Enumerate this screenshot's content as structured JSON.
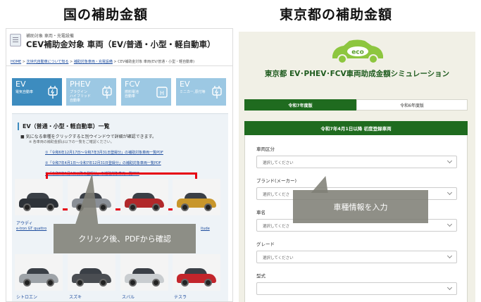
{
  "headings": {
    "left": "国の補助金額",
    "right": "東京都の補助金額"
  },
  "left_page": {
    "category": "補助対象 車両・充電設備",
    "title": "CEV補助金対象 車両（EV/普通・小型・軽自動車）",
    "breadcrumb": {
      "home": "HOME",
      "sep": ">",
      "items": [
        "次世代自動車について知る",
        "補助対象車両・充電設備",
        "CEV補助金対象 車両(EV/普通・小型・軽自動車)"
      ]
    },
    "tiles": [
      {
        "title": "EV",
        "sub1": "電気自動車",
        "sub2": "",
        "sub3": "",
        "icon": "ev-plug-icon"
      },
      {
        "title": "PHEV",
        "sub1": "プラグイン",
        "sub2": "ハイブリッド",
        "sub3": "自動車",
        "icon": "phev-plug-icon"
      },
      {
        "title": "FCV",
        "sub1": "燃料電池",
        "sub2": "自動車",
        "sub3": "",
        "icon": "fcv-h2-icon"
      },
      {
        "title": "EV",
        "sub1": "ミニカー,原付等",
        "sub2": "",
        "sub3": "",
        "icon": "mini-plug-icon"
      }
    ],
    "section": {
      "title": "EV（普通・小型・軽自動車）一覧",
      "note": "■ 気になる車種をクリックすると別ウインドウで詳細が確認できます。",
      "note2": "※ 各車両の補助金額は以下の一覧をご確認ください。",
      "pdf_links": [
        "①「令和6年12月17日〜令和7年3月31日登録分」の補助対象車両一覧PDF",
        "②「令和7年4月1日〜令和7年12月31日登録分」の補助対象車両一覧PDF",
        "③「令和8年1月1日以降の登録分」の補助対象車両一覧PDF"
      ]
    },
    "cars": [
      {
        "color": "#2d3238"
      },
      {
        "color": "#8a8f96"
      },
      {
        "color": "#b1282a"
      },
      {
        "color": "#c8962b"
      },
      {
        "color": "#9ea3a8"
      },
      {
        "color": "#4a4d52"
      },
      {
        "color": "#c9cdd0"
      },
      {
        "color": "#c3252b"
      }
    ],
    "makers": {
      "audi": "アウディ",
      "audi_model": "e-tron GT quattro",
      "citroen": "シトロエン",
      "suzuki": "スズキ",
      "subaru": "スバル",
      "tesla": "テスラ",
      "partial_model": "itude"
    },
    "callout": "クリック後、PDFから確認"
  },
  "right_page": {
    "logo_text": "eco",
    "title": "東京都 EV･PHEV･FCV車両助成金額シミュレーション",
    "tabs": [
      "令和7年度版",
      "令和6年度版"
    ],
    "form_header": "令和7年4月1日以降 初度登録車両",
    "fields": [
      {
        "label": "車両区分",
        "placeholder": "選択してください"
      },
      {
        "label": "ブランド(メーカー)",
        "placeholder": "選択してくださ"
      },
      {
        "label": "車名",
        "placeholder": "選択してくださ"
      },
      {
        "label": "グレード",
        "placeholder": "選択してください"
      },
      {
        "label": "型式",
        "placeholder": ""
      }
    ],
    "callout": "車種情報を入力"
  },
  "colors": {
    "tile_blue": "#3d8cbf",
    "tile_light": "#9cc8e3",
    "tokyo_green": "#1f6b1f",
    "highlight_red": "#e60012",
    "callout_gray": "#80807a"
  }
}
